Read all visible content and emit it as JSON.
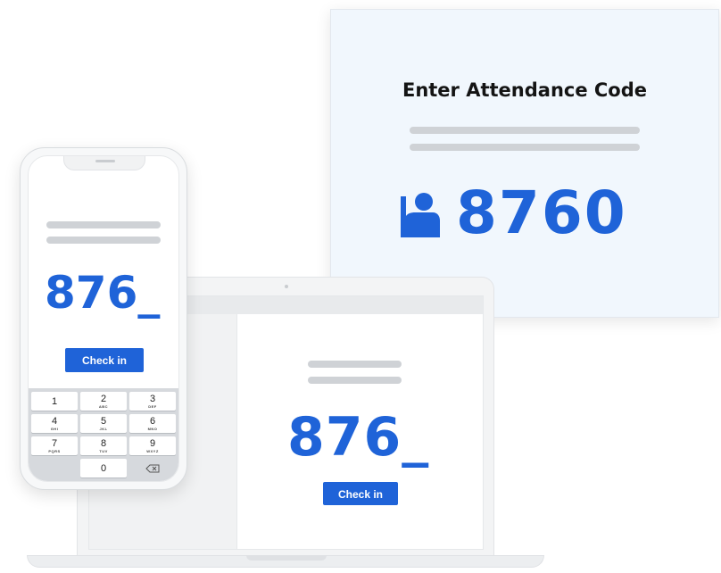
{
  "display": {
    "title": "Enter Attendance Code",
    "code": "8760",
    "icon": "hand-raise-icon"
  },
  "laptop": {
    "code": "876_",
    "button_label": "Check in"
  },
  "phone": {
    "code": "876_",
    "button_label": "Check in",
    "keypad": [
      {
        "digit": "1",
        "letters": ""
      },
      {
        "digit": "2",
        "letters": "ABC"
      },
      {
        "digit": "3",
        "letters": "DEF"
      },
      {
        "digit": "4",
        "letters": "GHI"
      },
      {
        "digit": "5",
        "letters": "JKL"
      },
      {
        "digit": "6",
        "letters": "MNO"
      },
      {
        "digit": "7",
        "letters": "PQRS"
      },
      {
        "digit": "8",
        "letters": "TUV"
      },
      {
        "digit": "9",
        "letters": "WXYZ"
      },
      {
        "digit": "0",
        "letters": ""
      }
    ],
    "backspace_icon": "backspace-icon"
  },
  "colors": {
    "accent": "#1f63d8",
    "display_bg": "#f1f7fd",
    "placeholder_line": "#cfd2d6"
  }
}
